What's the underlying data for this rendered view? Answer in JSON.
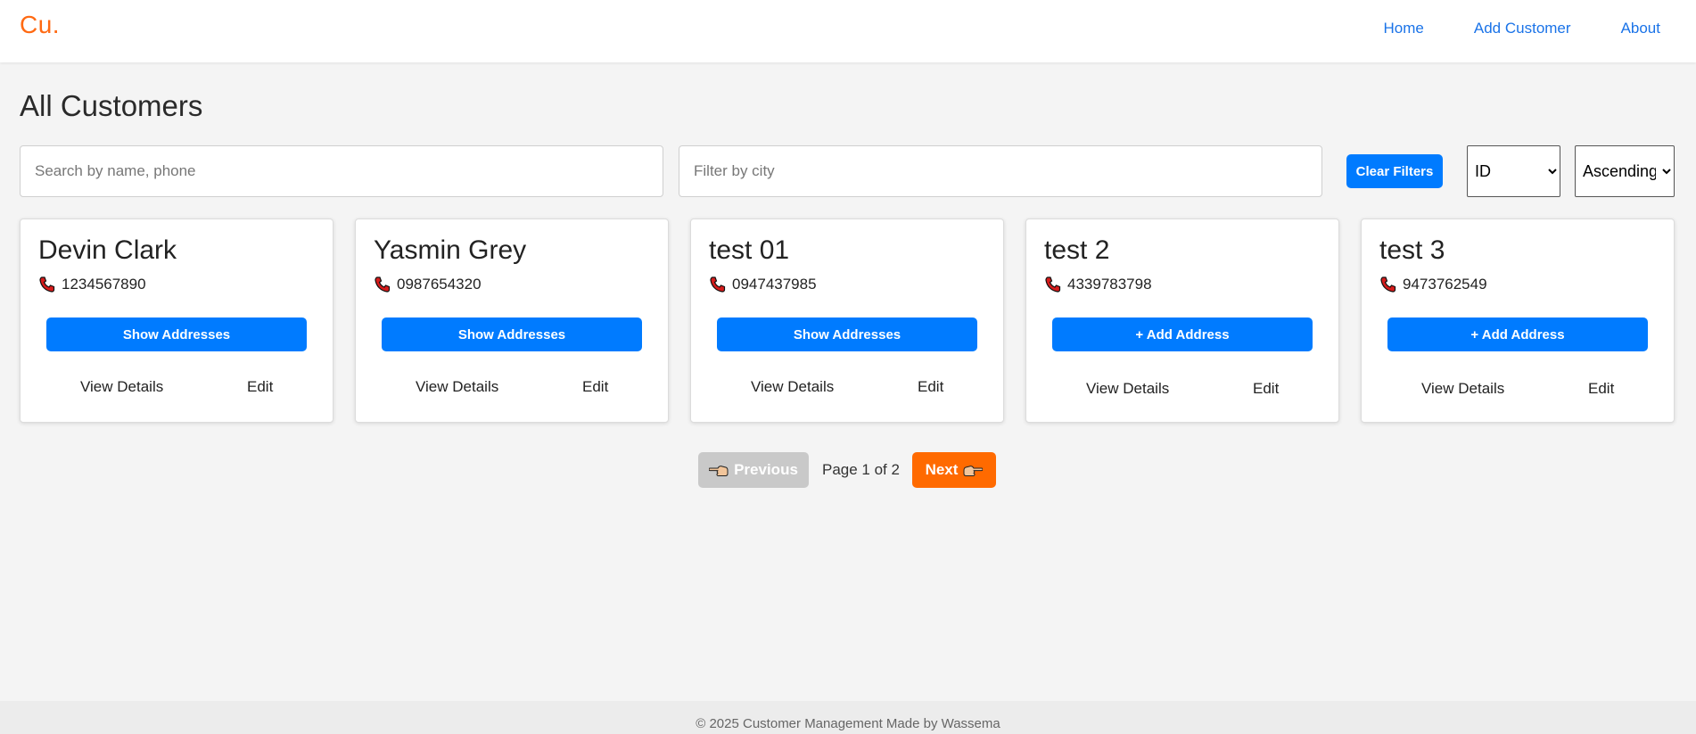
{
  "brand": "Cu.",
  "nav": {
    "home": "Home",
    "add_customer": "Add Customer",
    "about": "About"
  },
  "page_title": "All Customers",
  "filters": {
    "search_placeholder": "Search by name, phone",
    "city_placeholder": "Filter by city",
    "clear_label": "Clear Filters",
    "sort_field": "ID",
    "sort_order": "Ascending"
  },
  "customers": [
    {
      "name": "Devin Clark",
      "phone": "1234567890",
      "action": "Show Addresses",
      "view": "View Details",
      "edit": "Edit"
    },
    {
      "name": "Yasmin Grey",
      "phone": "0987654320",
      "action": "Show Addresses",
      "view": "View Details",
      "edit": "Edit"
    },
    {
      "name": "test 01",
      "phone": "0947437985",
      "action": "Show Addresses",
      "view": "View Details",
      "edit": "Edit"
    },
    {
      "name": "test 2",
      "phone": "4339783798",
      "action": "+ Add Address",
      "view": "View Details",
      "edit": "Edit"
    },
    {
      "name": "test 3",
      "phone": "9473762549",
      "action": "+ Add Address",
      "view": "View Details",
      "edit": "Edit"
    }
  ],
  "pagination": {
    "previous": "Previous",
    "page_info": "Page 1 of 2",
    "next": "Next"
  },
  "footer": "© 2025 Customer Management Made by Wassema",
  "colors": {
    "brand": "#ff6a13",
    "primary": "#007bff",
    "next": "#ff6a00",
    "disabled": "#c9c9c9"
  }
}
